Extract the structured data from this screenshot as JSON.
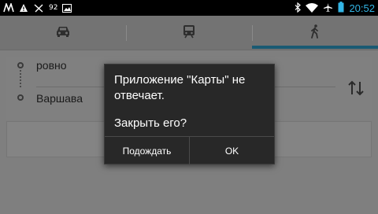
{
  "status_bar": {
    "battery_percent": "92",
    "time": "20:52",
    "left_icons": [
      "notification-n-icon",
      "warning-icon",
      "call-icon",
      "battery-percent-icon",
      "image-icon"
    ],
    "right_icons": [
      "bluetooth-icon",
      "wifi-icon",
      "airplane-icon",
      "battery-icon"
    ]
  },
  "tabs": [
    {
      "icon": "car-icon",
      "selected": false
    },
    {
      "icon": "train-icon",
      "selected": false
    },
    {
      "icon": "walk-icon",
      "selected": true
    }
  ],
  "route": {
    "from": "ровно",
    "to": "Варшава"
  },
  "dialog": {
    "message": "Приложение \"Карты\" не отвечает.",
    "question": "Закрыть его?",
    "wait_label": "Подождать",
    "ok_label": "OK"
  },
  "colors": {
    "accent": "#33b5e5",
    "dialog_bg": "#282828",
    "dim_overlay": "#7f7f7f"
  }
}
